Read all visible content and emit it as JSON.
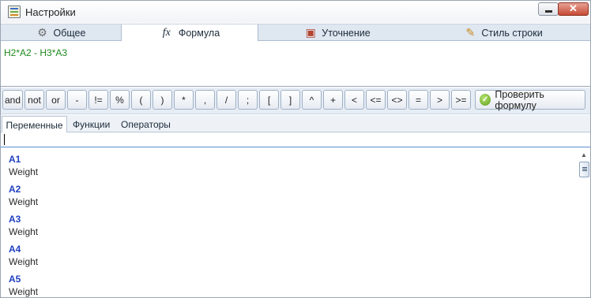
{
  "window": {
    "title": "Настройки",
    "minimize_glyph": "",
    "close_glyph": "✕"
  },
  "tabs": [
    {
      "label": "Общее",
      "icon": "gear-icon",
      "glyph": "⚙"
    },
    {
      "label": "Формула",
      "icon": "fx-icon",
      "glyph": "fx"
    },
    {
      "label": "Уточнение",
      "icon": "refine-icon",
      "glyph": "▣"
    },
    {
      "label": "Стиль строки",
      "icon": "row-style-icon",
      "glyph": "✎"
    }
  ],
  "active_tab": "Формула",
  "formula": {
    "text": "H2*A2 - H3*A3",
    "color": "#1f8a1f"
  },
  "operators": [
    "and",
    "not",
    "or",
    "-",
    "!=",
    "%",
    "(",
    ")",
    "*",
    ",",
    "/",
    ";",
    "[",
    "]",
    "^",
    "+",
    "<",
    "<=",
    "<>",
    "=",
    ">",
    ">="
  ],
  "check_button": {
    "label": "Проверить формулу",
    "icon": "check-circle-icon",
    "glyph": "✓"
  },
  "subtabs": [
    {
      "label": "Переменные"
    },
    {
      "label": "Функции"
    },
    {
      "label": "Операторы"
    }
  ],
  "active_subtab": "Переменные",
  "search": {
    "value": "",
    "placeholder": ""
  },
  "variables": [
    {
      "name": "A1",
      "type": "Weight"
    },
    {
      "name": "A2",
      "type": "Weight"
    },
    {
      "name": "A3",
      "type": "Weight"
    },
    {
      "name": "A4",
      "type": "Weight"
    },
    {
      "name": "A5",
      "type": "Weight"
    }
  ],
  "scrollbar": {
    "up_glyph": "▲"
  },
  "colors": {
    "variable_name": "#2040c0",
    "tab_strip": "#dfe7f1",
    "close_button": "#c64a34"
  }
}
